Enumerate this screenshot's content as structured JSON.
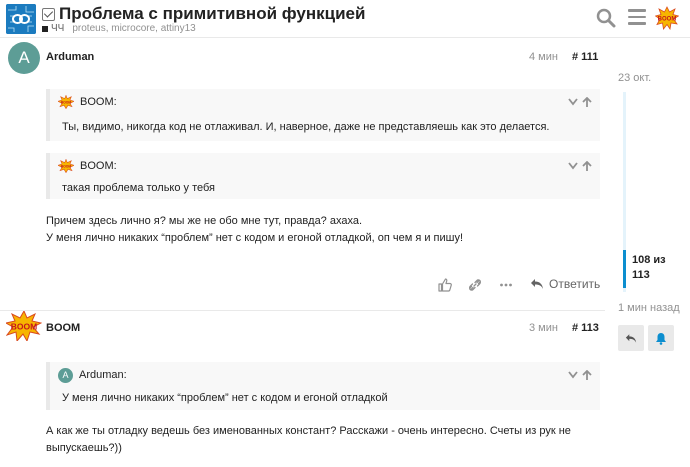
{
  "header": {
    "title": "Проблема с примитивной функцией",
    "category": "ЧЧ",
    "tags": "proteus, microcore, attiny13"
  },
  "posts": [
    {
      "author": "Arduman",
      "avatar_letter": "A",
      "time": "4 мин",
      "number": "# 111",
      "quotes": [
        {
          "author": "BOOM:",
          "text": "Ты, видимо, никогда код не отлаживал. И, наверное, даже не представляешь как это делается."
        },
        {
          "author": "BOOM:",
          "text": "такая проблема только у тебя"
        }
      ],
      "text_lines": [
        "Причем здесь лично я? мы же не обо мне тут, правда? ахаха.",
        "У меня лично никаких “проблем” нет с кодом и егоной отладкой, оп чем я и пишу!"
      ],
      "reply_label": "Ответить"
    },
    {
      "author": "BOOM",
      "time": "3 мин",
      "number": "# 113",
      "quotes": [
        {
          "avatar_letter": "A",
          "author": "Arduman:",
          "text": "У меня лично никаких “проблем” нет с кодом и егоной отладкой"
        }
      ],
      "text_lines": [
        "А как же ты отладку ведешь без именованных констант? Расскажи - очень интересно. Счеты из рук не",
        "выпускаешь?))"
      ]
    }
  ],
  "timeline": {
    "date_top": "23 окт.",
    "count_line1": "108 из",
    "count_line2": "113",
    "date_bottom": "1 мин назад"
  },
  "colors": {
    "accent": "#0c8ecf",
    "avatar": "#5d9d96"
  }
}
